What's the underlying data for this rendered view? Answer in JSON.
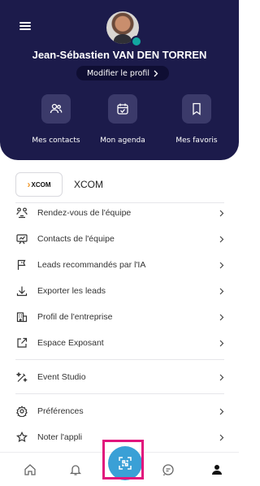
{
  "header": {
    "user_name": "Jean-Sébastien VAN DEN TORREN",
    "edit_profile_label": "Modifier le profil",
    "quick_actions": [
      {
        "label": "Mes contacts",
        "icon": "contacts-icon"
      },
      {
        "label": "Mon agenda",
        "icon": "calendar-check-icon"
      },
      {
        "label": "Mes favoris",
        "icon": "bookmark-icon"
      }
    ]
  },
  "company": {
    "logo_text": "XCOM",
    "name": "XCOM"
  },
  "menu": {
    "items": [
      {
        "label": "Rendez-vous de l'équipe",
        "icon": "team-meeting-icon"
      },
      {
        "label": "Contacts de l'équipe",
        "icon": "team-contacts-icon"
      },
      {
        "label": "Leads recommandés par l'IA",
        "icon": "flag-icon"
      },
      {
        "label": "Exporter les leads",
        "icon": "download-icon"
      },
      {
        "label": "Profil de l'entreprise",
        "icon": "building-icon"
      },
      {
        "label": "Espace Exposant",
        "icon": "external-link-icon"
      },
      {
        "label": "Event Studio",
        "icon": "magic-wand-icon"
      },
      {
        "label": "Préférences",
        "icon": "settings-icon"
      },
      {
        "label": "Noter l'appli",
        "icon": "star-icon"
      }
    ]
  },
  "tabbar": {
    "tabs": [
      "home-icon",
      "bell-icon",
      "scan-icon",
      "chat-icon",
      "profile-icon"
    ],
    "active": "profile-icon"
  },
  "colors": {
    "header_bg": "#1c1b4b",
    "accent": "#3aa0d6",
    "highlight": "#e1157c"
  }
}
